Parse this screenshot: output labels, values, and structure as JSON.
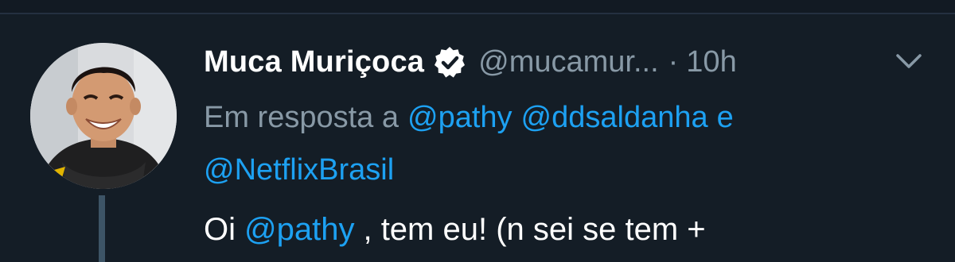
{
  "tweet": {
    "author_name": "Muca Muriçoca",
    "verified_icon": "verified-badge-icon",
    "handle": "@mucamur...",
    "separator": "·",
    "time": "10h",
    "menu_icon": "chevron-down-icon",
    "reply_prefix": "Em resposta a",
    "reply_mentions": [
      "@pathy",
      "@ddsaldanha",
      "@NetflixBrasil"
    ],
    "reply_conjunction": "e",
    "body": {
      "text_start": "Oi",
      "mention": "@pathy",
      "text_end": ", tem eu! (n sei se tem +"
    }
  },
  "colors": {
    "background": "#141d26",
    "text": "#ffffff",
    "muted": "#8899a6",
    "link": "#1da1f2",
    "thread_line": "#3d5466"
  }
}
